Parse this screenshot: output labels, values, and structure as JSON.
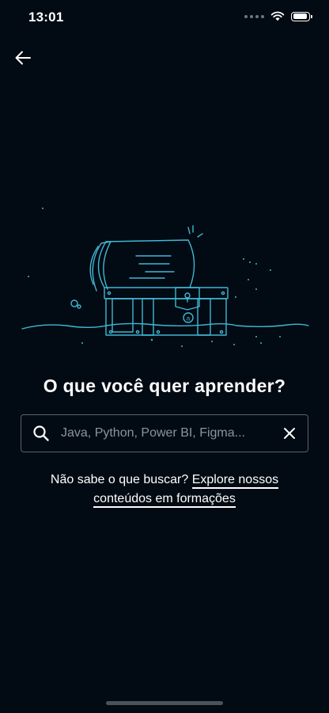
{
  "status_bar": {
    "time": "13:01",
    "battery_level": 0.9
  },
  "navigation": {
    "back_icon": "arrow-left-icon"
  },
  "illustration": {
    "icon": "treasure-chest-illustration",
    "accent_color": "#3fb8d4"
  },
  "main": {
    "heading": "O que você quer aprender?",
    "search": {
      "placeholder": "Java, Python, Power BI, Figma...",
      "value": "",
      "search_icon": "search-icon",
      "clear_icon": "close-icon"
    },
    "helper": {
      "text": "Não sabe o que buscar?",
      "link_label": "Explore nossos conteúdos em formações"
    }
  },
  "colors": {
    "background": "#020a13",
    "text": "#ffffff",
    "border": "#59636e",
    "placeholder": "#8b939c"
  }
}
